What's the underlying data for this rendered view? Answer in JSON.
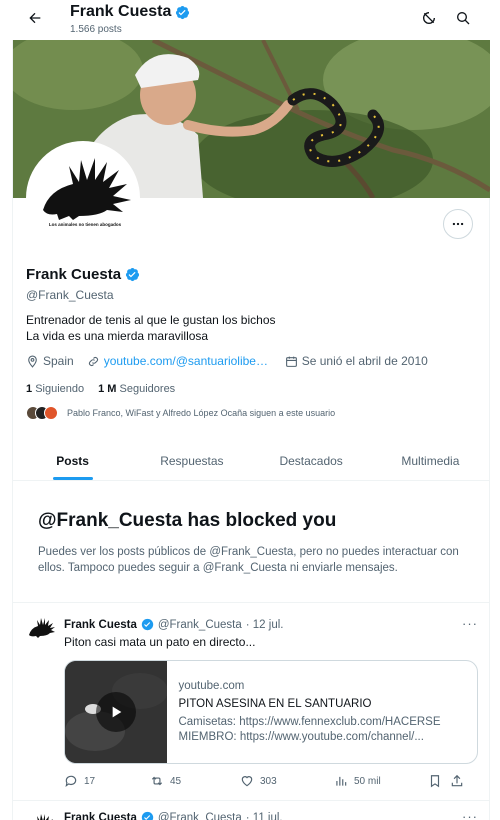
{
  "header": {
    "name": "Frank Cuesta",
    "posts_count": "1.566 posts"
  },
  "profile": {
    "name": "Frank Cuesta",
    "handle": "@Frank_Cuesta",
    "avatar_caption": "Los animales no tienen abogados",
    "bio_line1": "Entrenador de tenis al que le gustan los bichos",
    "bio_line2": "La vida es una mierda maravillosa",
    "location": "Spain",
    "link": "youtube.com/@santuariolibertad",
    "joined": "Se unió el abril de 2010",
    "following_count": "1",
    "following_label": "Siguiendo",
    "followers_count": "1 M",
    "followers_label": "Seguidores",
    "followed_by": "Pablo Franco, WiFast y Alfredo López Ocaña siguen a este usuario"
  },
  "tabs": [
    {
      "label": "Posts"
    },
    {
      "label": "Respuestas"
    },
    {
      "label": "Destacados"
    },
    {
      "label": "Multimedia"
    }
  ],
  "blocked": {
    "title": "@Frank_Cuesta has blocked you",
    "message": "Puedes ver los posts públicos de @Frank_Cuesta, pero no puedes interactuar con ellos. Tampoco puedes seguir a @Frank_Cuesta ni enviarle mensajes."
  },
  "tweets": [
    {
      "name": "Frank Cuesta",
      "handle": "@Frank_Cuesta",
      "date": "· 12 jul.",
      "text": "Piton casi mata un pato en directo...",
      "card": {
        "domain": "youtube.com",
        "title": "PITON ASESINA EN EL SANTUARIO",
        "description": "Camisetas: https://www.fennexclub.com/HACERSE MIEMBRO: https://www.youtube.com/channel/..."
      },
      "replies": "17",
      "reposts": "45",
      "likes": "303",
      "views": "50 mil"
    },
    {
      "name": "Frank Cuesta",
      "handle": "@Frank_Cuesta",
      "date": "· 11 jul."
    }
  ],
  "colors": {
    "accent": "#1d9bf0",
    "text": "#0f1419",
    "muted": "#536471",
    "border": "#eff3f4"
  }
}
